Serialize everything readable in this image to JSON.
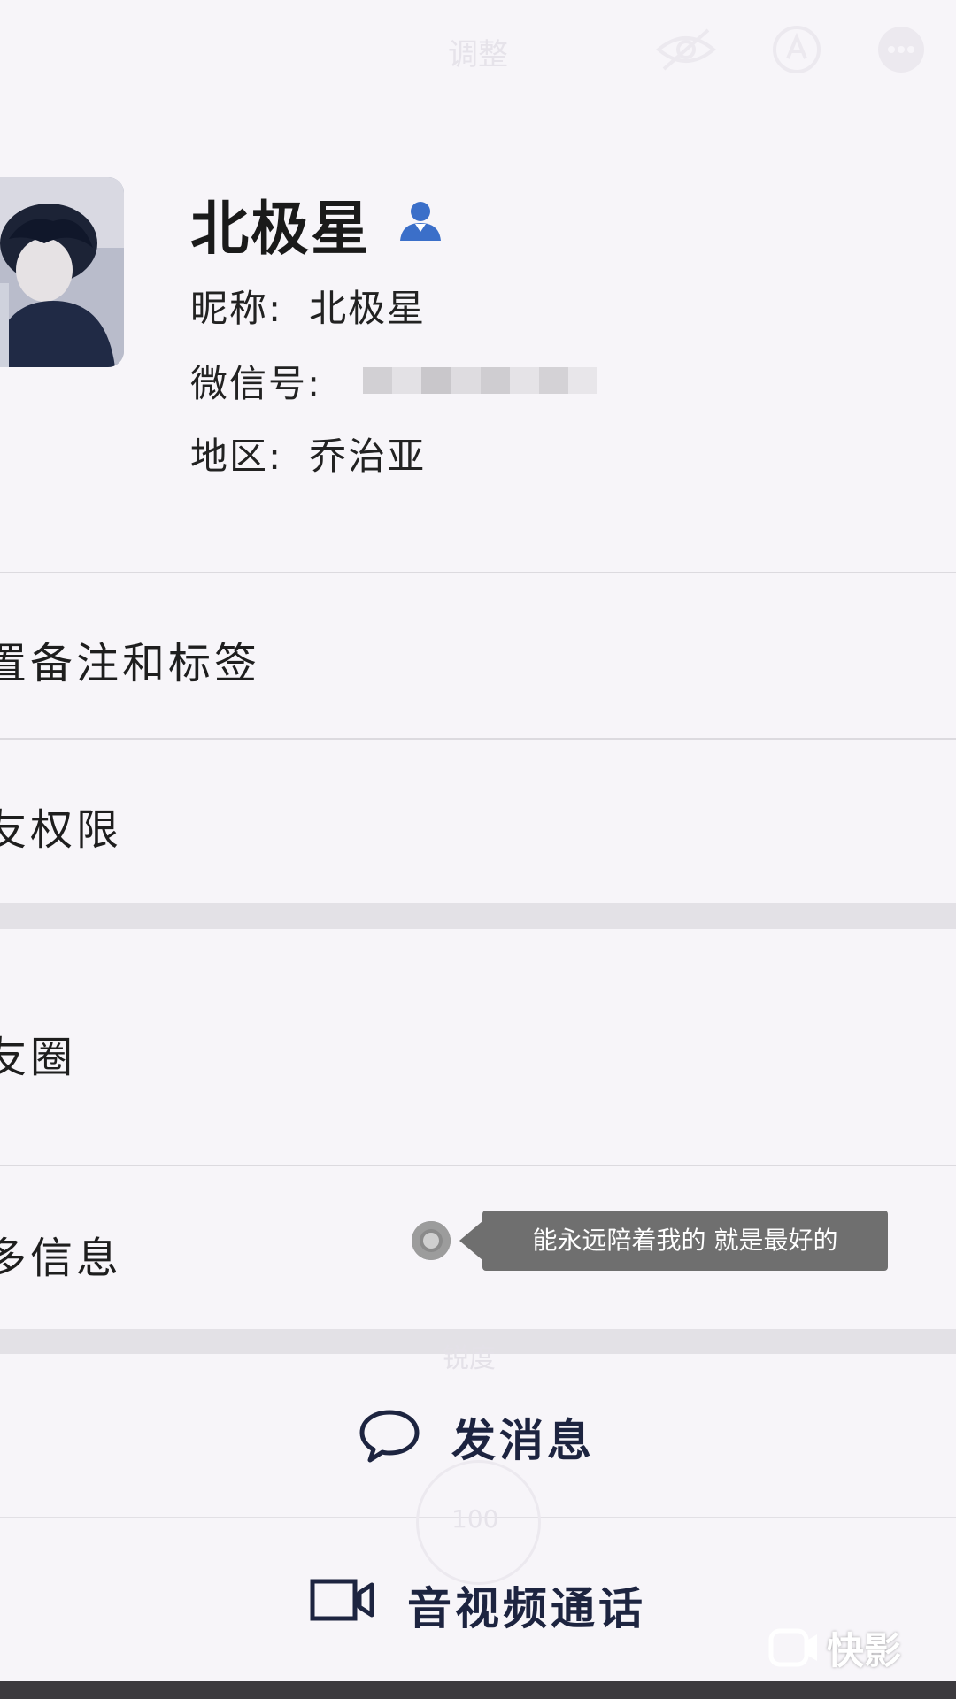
{
  "topbar": {
    "title": "调整",
    "icons": [
      "eye-off-icon",
      "pen-tool-icon",
      "more-icon"
    ]
  },
  "profile": {
    "name": "北极星",
    "gender_icon": "person-icon",
    "nickname_label": "昵称:",
    "nickname_value": "北极星",
    "wechat_label": "微信号:",
    "region_label": "地区:",
    "region_value": "乔治亚"
  },
  "rows": {
    "remark_label": "置备注和标签",
    "permission_label": "友权限",
    "moments_label": "友圈",
    "more_info_label": "多信息"
  },
  "toast": {
    "text": "能永远陪着我的 就是最好的"
  },
  "overlay": {
    "mid_label": "锐度",
    "dial_value": "100"
  },
  "actions": {
    "message_label": "发消息",
    "call_label": "音视频通话"
  },
  "watermark": {
    "text": "快影"
  },
  "colors": {
    "background": "#f7f5f9",
    "divider": "#dcdadf",
    "band": "#e3e1e6",
    "toast": "#6f6f6f",
    "action_text": "#1d2440",
    "gender_icon": "#3b6fc9"
  }
}
